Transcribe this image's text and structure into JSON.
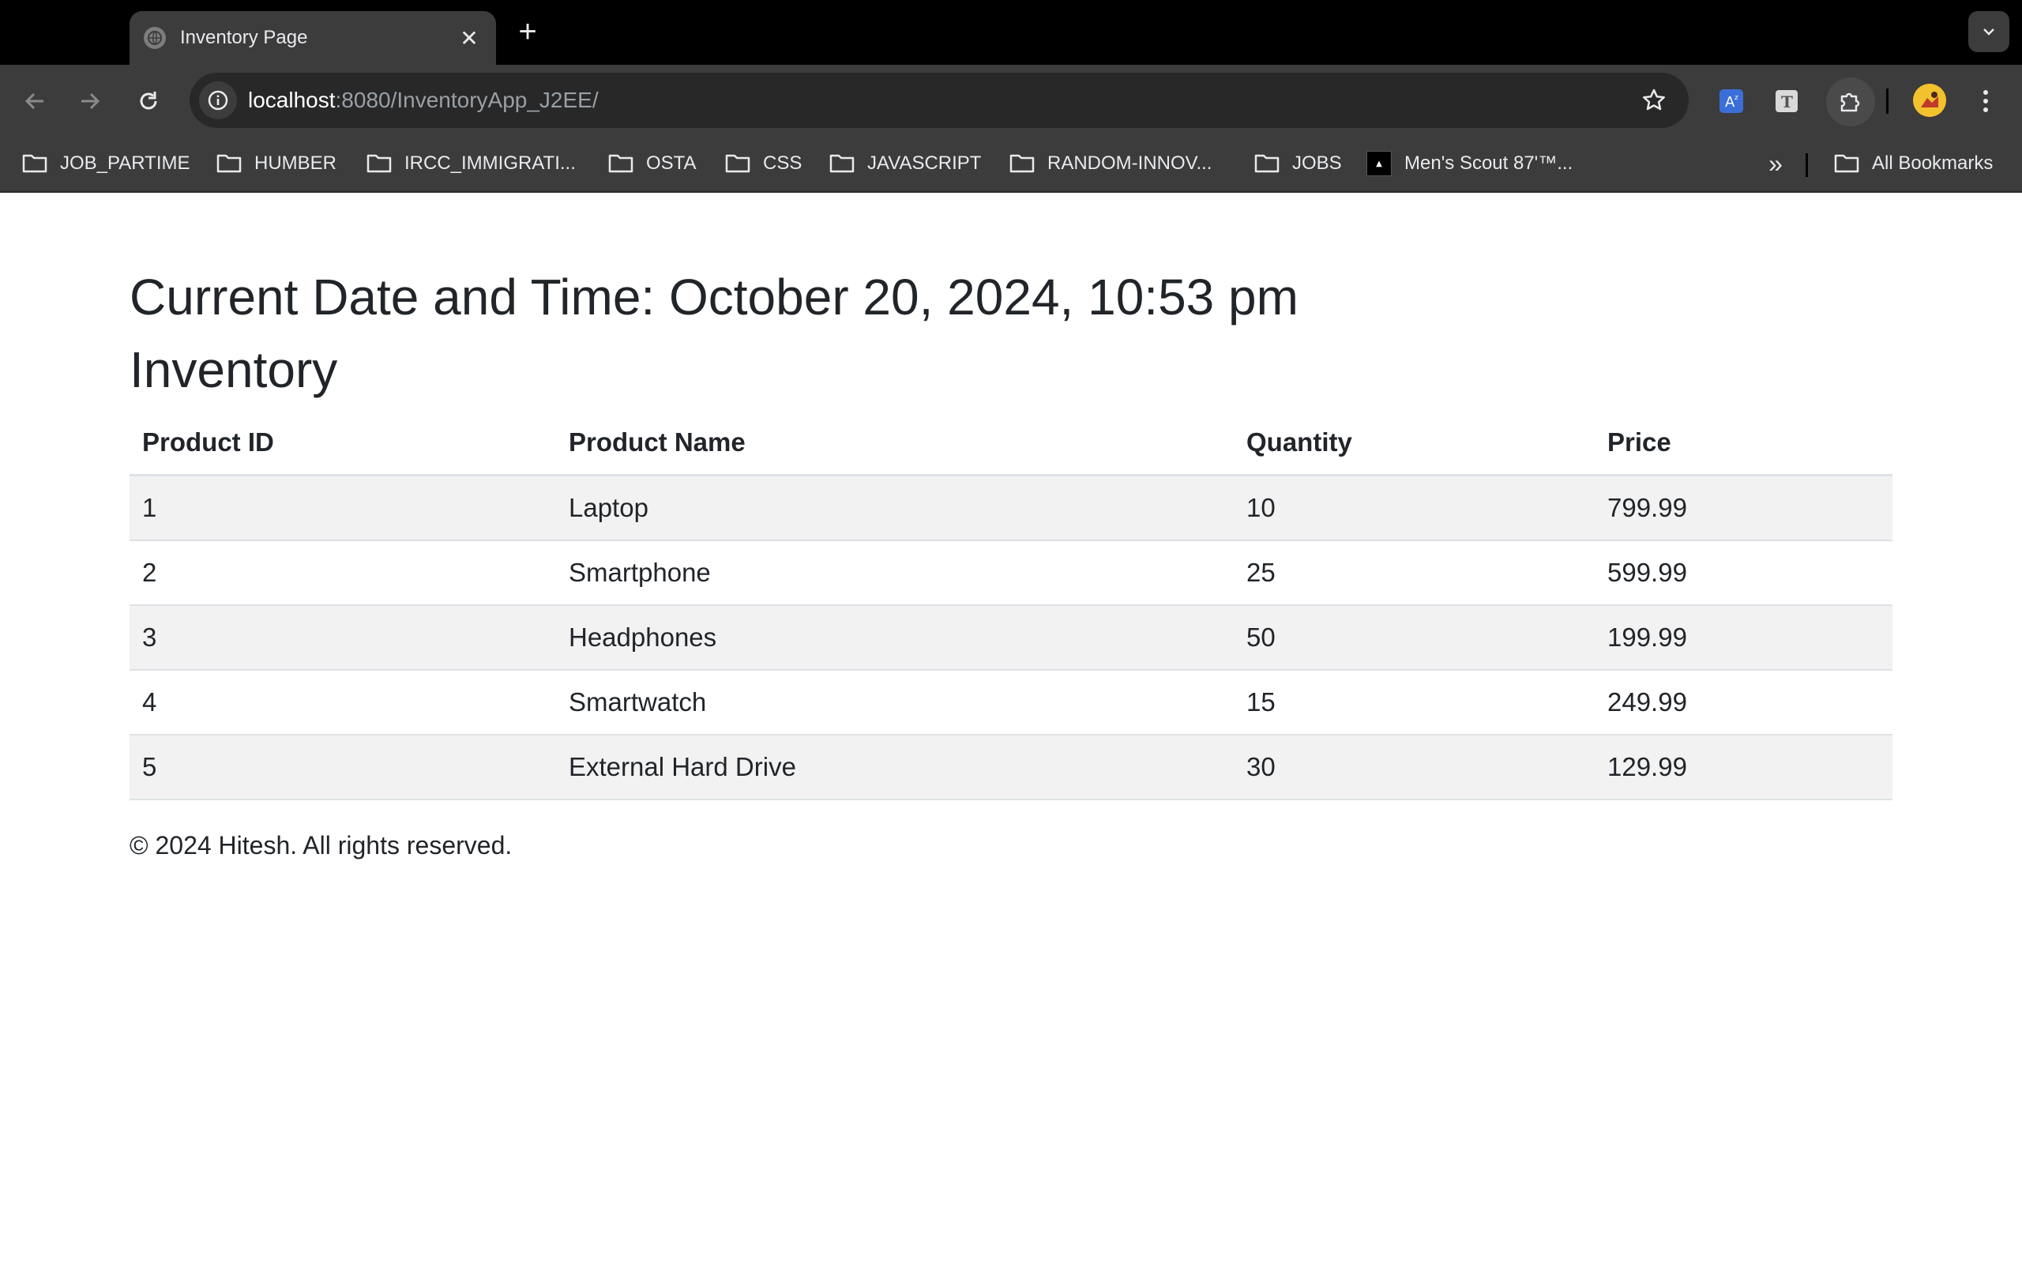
{
  "browser": {
    "tab_title": "Inventory Page",
    "url_host": "localhost",
    "url_rest": ":8080/InventoryApp_J2EE/",
    "bookmarks": [
      "JOB_PARTIME",
      "HUMBER",
      "IRCC_IMMIGRATI...",
      "OSTA",
      "CSS",
      "JAVASCRIPT",
      "RANDOM-INNOV...",
      "JOBS",
      "Men's Scout 87'™..."
    ],
    "all_bookmarks": "All Bookmarks"
  },
  "page": {
    "datetime_heading": "Current Date and Time: October 20, 2024, 10:53 pm",
    "inventory_heading": "Inventory",
    "table": {
      "headers": [
        "Product ID",
        "Product Name",
        "Quantity",
        "Price"
      ],
      "rows": [
        [
          "1",
          "Laptop",
          "10",
          "799.99"
        ],
        [
          "2",
          "Smartphone",
          "25",
          "599.99"
        ],
        [
          "3",
          "Headphones",
          "50",
          "199.99"
        ],
        [
          "4",
          "Smartwatch",
          "15",
          "249.99"
        ],
        [
          "5",
          "External Hard Drive",
          "30",
          "129.99"
        ]
      ]
    },
    "footer": "© 2024 Hitesh. All rights reserved."
  }
}
